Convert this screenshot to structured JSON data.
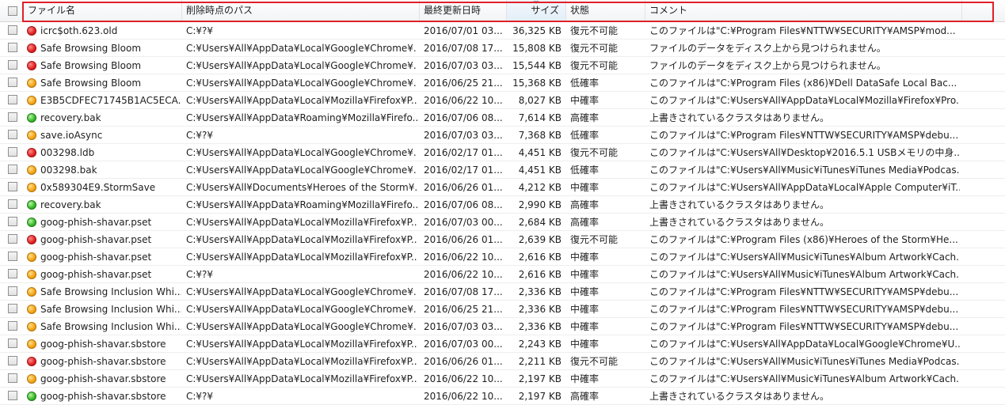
{
  "header": {
    "name": "ファイル名",
    "path": "削除時点のパス",
    "date": "最終更新日時",
    "size": "サイズ",
    "state": "状態",
    "comment": "コメント"
  },
  "status_colors": {
    "red": "#e02020",
    "orange": "#f3a312",
    "green": "#34b824"
  },
  "rows": [
    {
      "status": "red",
      "name": "icrc$oth.623.old",
      "path": "C:¥?¥",
      "date": "2016/07/01 03...",
      "size": "36,325 KB",
      "state": "復元不可能",
      "comment": "このファイルは\"C:¥Program Files¥NTTW¥SECURITY¥AMSP¥mod..."
    },
    {
      "status": "red",
      "name": "Safe Browsing Bloom",
      "path": "C:¥Users¥All¥AppData¥Local¥Google¥Chrome¥...",
      "date": "2016/07/08 17...",
      "size": "15,808 KB",
      "state": "復元不可能",
      "comment": "ファイルのデータをディスク上から見つけられません。"
    },
    {
      "status": "red",
      "name": "Safe Browsing Bloom",
      "path": "C:¥Users¥All¥AppData¥Local¥Google¥Chrome¥...",
      "date": "2016/07/03 03...",
      "size": "15,544 KB",
      "state": "復元不可能",
      "comment": "ファイルのデータをディスク上から見つけられません。"
    },
    {
      "status": "orange",
      "name": "Safe Browsing Bloom",
      "path": "C:¥Users¥All¥AppData¥Local¥Google¥Chrome¥...",
      "date": "2016/06/25 21...",
      "size": "15,368 KB",
      "state": "低確率",
      "comment": "このファイルは\"C:¥Program Files (x86)¥Dell DataSafe Local Bac..."
    },
    {
      "status": "orange",
      "name": "E3B5CDFEC71745B1AC5ECA...",
      "path": "C:¥Users¥All¥AppData¥Local¥Mozilla¥Firefox¥P...",
      "date": "2016/06/22 10...",
      "size": "8,027 KB",
      "state": "中確率",
      "comment": "このファイルは\"C:¥Users¥All¥AppData¥Local¥Mozilla¥Firefox¥Pro..."
    },
    {
      "status": "green",
      "name": "recovery.bak",
      "path": "C:¥Users¥All¥AppData¥Roaming¥Mozilla¥Firefo...",
      "date": "2016/07/06 08...",
      "size": "7,614 KB",
      "state": "高確率",
      "comment": "上書きされているクラスタはありません。"
    },
    {
      "status": "orange",
      "name": "save.ioAsync",
      "path": "C:¥?¥",
      "date": "2016/07/03 03...",
      "size": "7,368 KB",
      "state": "低確率",
      "comment": "このファイルは\"C:¥Program Files¥NTTW¥SECURITY¥AMSP¥debu..."
    },
    {
      "status": "red",
      "name": "003298.ldb",
      "path": "C:¥Users¥All¥AppData¥Local¥Google¥Chrome¥...",
      "date": "2016/02/17 01...",
      "size": "4,451 KB",
      "state": "復元不可能",
      "comment": "このファイルは\"C:¥Users¥All¥Desktop¥2016.5.1 USBメモリの中身..."
    },
    {
      "status": "orange",
      "name": "003298.bak",
      "path": "C:¥Users¥All¥AppData¥Local¥Google¥Chrome¥...",
      "date": "2016/02/17 01...",
      "size": "4,451 KB",
      "state": "低確率",
      "comment": "このファイルは\"C:¥Users¥All¥Music¥iTunes¥iTunes Media¥Podcas..."
    },
    {
      "status": "orange",
      "name": "0x589304E9.StormSave",
      "path": "C:¥Users¥All¥Documents¥Heroes of the Storm¥...",
      "date": "2016/06/26 01...",
      "size": "4,212 KB",
      "state": "中確率",
      "comment": "このファイルは\"C:¥Users¥All¥AppData¥Local¥Apple Computer¥iT..."
    },
    {
      "status": "green",
      "name": "recovery.bak",
      "path": "C:¥Users¥All¥AppData¥Roaming¥Mozilla¥Firefo...",
      "date": "2016/07/06 08...",
      "size": "2,990 KB",
      "state": "高確率",
      "comment": "上書きされているクラスタはありません。"
    },
    {
      "status": "green",
      "name": "goog-phish-shavar.pset",
      "path": "C:¥Users¥All¥AppData¥Local¥Mozilla¥Firefox¥P...",
      "date": "2016/07/03 00...",
      "size": "2,684 KB",
      "state": "高確率",
      "comment": "上書きされているクラスタはありません。"
    },
    {
      "status": "red",
      "name": "goog-phish-shavar.pset",
      "path": "C:¥Users¥All¥AppData¥Local¥Mozilla¥Firefox¥P...",
      "date": "2016/06/26 01...",
      "size": "2,639 KB",
      "state": "復元不可能",
      "comment": "このファイルは\"C:¥Program Files (x86)¥Heroes of the Storm¥He..."
    },
    {
      "status": "orange",
      "name": "goog-phish-shavar.pset",
      "path": "C:¥Users¥All¥AppData¥Local¥Mozilla¥Firefox¥P...",
      "date": "2016/06/22 10...",
      "size": "2,616 KB",
      "state": "中確率",
      "comment": "このファイルは\"C:¥Users¥All¥Music¥iTunes¥Album Artwork¥Cach..."
    },
    {
      "status": "orange",
      "name": "goog-phish-shavar.pset",
      "path": "C:¥?¥",
      "date": "2016/06/22 10...",
      "size": "2,616 KB",
      "state": "中確率",
      "comment": "このファイルは\"C:¥Users¥All¥Music¥iTunes¥Album Artwork¥Cach..."
    },
    {
      "status": "orange",
      "name": "Safe Browsing Inclusion Whi...",
      "path": "C:¥Users¥All¥AppData¥Local¥Google¥Chrome¥...",
      "date": "2016/07/08 17...",
      "size": "2,336 KB",
      "state": "中確率",
      "comment": "このファイルは\"C:¥Program Files¥NTTW¥SECURITY¥AMSP¥debu..."
    },
    {
      "status": "orange",
      "name": "Safe Browsing Inclusion Whi...",
      "path": "C:¥Users¥All¥AppData¥Local¥Google¥Chrome¥...",
      "date": "2016/06/25 21...",
      "size": "2,336 KB",
      "state": "中確率",
      "comment": "このファイルは\"C:¥Program Files¥NTTW¥SECURITY¥AMSP¥debu..."
    },
    {
      "status": "orange",
      "name": "Safe Browsing Inclusion Whi...",
      "path": "C:¥Users¥All¥AppData¥Local¥Google¥Chrome¥...",
      "date": "2016/07/03 03...",
      "size": "2,336 KB",
      "state": "中確率",
      "comment": "このファイルは\"C:¥Program Files¥NTTW¥SECURITY¥AMSP¥debu..."
    },
    {
      "status": "orange",
      "name": "goog-phish-shavar.sbstore",
      "path": "C:¥Users¥All¥AppData¥Local¥Mozilla¥Firefox¥P...",
      "date": "2016/07/03 00...",
      "size": "2,243 KB",
      "state": "中確率",
      "comment": "このファイルは\"C:¥Users¥All¥AppData¥Local¥Google¥Chrome¥U..."
    },
    {
      "status": "red",
      "name": "goog-phish-shavar.sbstore",
      "path": "C:¥Users¥All¥AppData¥Local¥Mozilla¥Firefox¥P...",
      "date": "2016/06/26 01...",
      "size": "2,211 KB",
      "state": "復元不可能",
      "comment": "このファイルは\"C:¥Users¥All¥Music¥iTunes¥iTunes Media¥Podcas..."
    },
    {
      "status": "orange",
      "name": "goog-phish-shavar.sbstore",
      "path": "C:¥Users¥All¥AppData¥Local¥Mozilla¥Firefox¥P...",
      "date": "2016/06/22 10...",
      "size": "2,197 KB",
      "state": "中確率",
      "comment": "このファイルは\"C:¥Users¥All¥Music¥iTunes¥Album Artwork¥Cach..."
    },
    {
      "status": "green",
      "name": "goog-phish-shavar.sbstore",
      "path": "C:¥?¥",
      "date": "2016/06/22 10...",
      "size": "2,197 KB",
      "state": "高確率",
      "comment": "上書きされているクラスタはありません。"
    }
  ]
}
